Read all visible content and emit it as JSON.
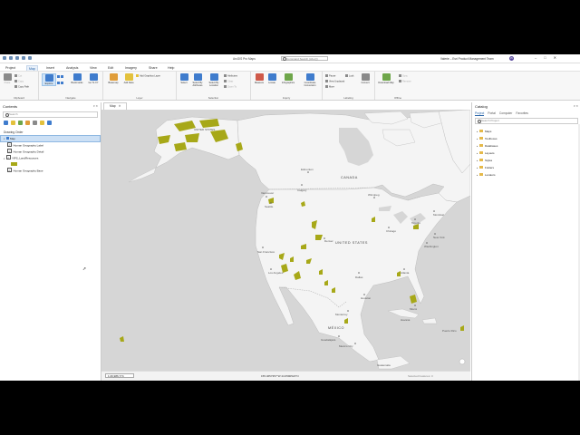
{
  "window": {
    "title": "ArcGIS Pro Maps",
    "command_search_placeholder": "Command Search (Alt+Q)",
    "user": "Valerie – Esri Product Management Team",
    "avatar_initials": "VC",
    "window_controls": [
      "–",
      "□",
      "✕"
    ]
  },
  "ribbon_tabs": [
    "Project",
    "Map",
    "Insert",
    "Analysis",
    "View",
    "Edit",
    "Imagery",
    "Share",
    "Help"
  ],
  "ribbon_active_tab": "Map",
  "ribbon": {
    "clipboard": {
      "label": "Clipboard",
      "paste": "Paste",
      "cut": "Cut",
      "copy": "Copy",
      "copy_path": "Copy Path"
    },
    "navigate": {
      "label": "Navigate",
      "explore": "Explore",
      "bookmarks": "Bookmarks",
      "goto": "Go To XY"
    },
    "layer": {
      "label": "Layer",
      "basemap": "Basemap",
      "add_data": "Add Data",
      "add_graphics": "Add Graphics Layer"
    },
    "selection": {
      "label": "Selection",
      "select": "Select",
      "by_attributes": "Select By Attributes",
      "by_location": "Select By Location",
      "attributes": "Attributes",
      "clear": "Clear",
      "zoom_to": "Zoom To"
    },
    "inquiry": {
      "label": "Inquiry",
      "measure": "Measure",
      "locate": "Locate",
      "infographics": "Infographics",
      "coordinate": "Coordinate Conversion"
    },
    "labeling": {
      "label": "Labeling",
      "pause": "Pause",
      "lock": "Lock",
      "view_unplaced": "View Unplaced",
      "more": "More",
      "convert": "Convert"
    },
    "offline": {
      "label": "Offline",
      "download": "Download Map",
      "sync": "Sync",
      "remove": "Remove"
    }
  },
  "contents": {
    "title": "Contents",
    "search_placeholder": "Search",
    "drawing_order": "Drawing Order",
    "map_name": "Map",
    "layers": [
      "Human Geography Label",
      "Human Geography Detail",
      "NPS_LandResources",
      "Human Geography Base"
    ]
  },
  "map": {
    "tab_label": "Map",
    "labels": {
      "canada": "CANADA",
      "united_states": "UNITED STATES",
      "mexico": "MÉXICO",
      "edmonton": "Edmonton",
      "calgary": "Calgary",
      "vancouver": "Vancouver",
      "seattle": "Seattle",
      "winnipeg": "Winnipeg",
      "montreal": "Montréal",
      "toronto": "Toronto",
      "chicago": "Chicago",
      "new_york": "New York",
      "washington": "Washington",
      "san_francisco": "San Francisco",
      "los_angeles": "Los Angeles",
      "denver": "Denver",
      "dallas": "Dallas",
      "houston": "Houston",
      "atlanta": "Atlanta",
      "miami": "Miami",
      "monterrey": "Monterrey",
      "guadalajara": "Guadalajara",
      "mexico_city": "Mexico City",
      "havana": "Havana",
      "united_states_ak": "UNITED STATES",
      "guatemala": "Guatemala",
      "puerto_rico": "Puerto Rico"
    },
    "scale": "1:26,986,774",
    "coordinates": "155.4657357°W 44.6590524°N",
    "selected_features": "Selected Features: 0"
  },
  "catalog": {
    "title": "Catalog",
    "tabs": [
      "Project",
      "Portal",
      "Computer",
      "Favorites"
    ],
    "active_tab": "Project",
    "search_placeholder": "Search Project",
    "items": [
      "Maps",
      "Toolboxes",
      "Databases",
      "Layouts",
      "Styles",
      "Folders",
      "Locators"
    ]
  },
  "colors": {
    "accent": "#2b66a8",
    "land_resources": "#a7a818",
    "land": "#f4f4f4",
    "water": "#d6d6d6"
  }
}
